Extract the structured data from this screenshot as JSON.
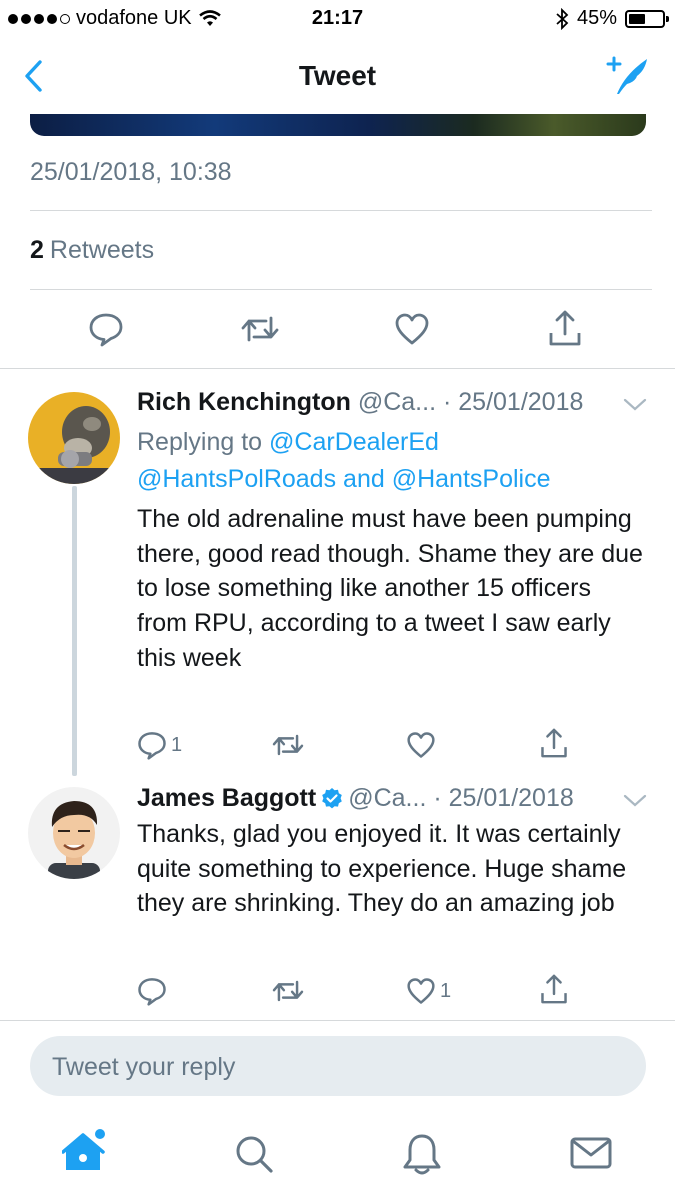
{
  "status_bar": {
    "carrier": "vodafone UK",
    "time": "21:17",
    "battery": "45%"
  },
  "nav": {
    "title": "Tweet"
  },
  "tweet": {
    "timestamp": "25/01/2018, 10:38",
    "retweet_count": "2",
    "retweet_label": "Retweets"
  },
  "replies": [
    {
      "name": "Rich Kenchington",
      "handle": "@Ca...",
      "date": "· 25/01/2018",
      "replying_prefix": "Replying to",
      "replying_1": "@CarDealerEd",
      "replying_2": "@HantsPolRoads",
      "replying_and": "and",
      "replying_3": "@HantsPolice",
      "text": "The old adrenaline must have been pumping there, good read though. Shame they are due to lose something like another 15 officers from RPU, according to a tweet I saw early this week",
      "reply_count": "1",
      "like_count": ""
    },
    {
      "name": "James Baggott",
      "handle": "@Ca...",
      "date": "· 25/01/2018",
      "verified": true,
      "text": "Thanks, glad you enjoyed it. It was certainly quite something to experience. Huge shame they are shrinking. They do an amazing job",
      "reply_count": "",
      "like_count": "1"
    }
  ],
  "reply_box": {
    "placeholder": "Tweet your reply"
  },
  "tab_bar": [
    "home-icon",
    "search-icon",
    "notifications-icon",
    "messages-icon"
  ],
  "colors": {
    "accent": "#1da1f2",
    "muted": "#657786",
    "text": "#14171a"
  }
}
